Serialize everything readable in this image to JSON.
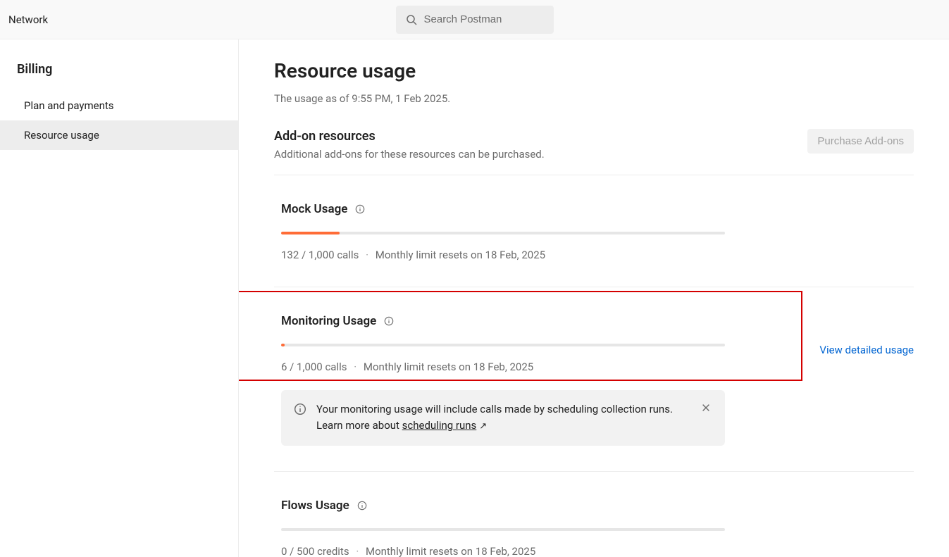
{
  "header": {
    "network_label": "Network",
    "search_placeholder": "Search Postman"
  },
  "sidebar": {
    "heading": "Billing",
    "items": [
      {
        "label": "Plan and payments",
        "active": false
      },
      {
        "label": "Resource usage",
        "active": true
      }
    ]
  },
  "main": {
    "title": "Resource usage",
    "asof_prefix": "The usage as of ",
    "asof_time": "9:55 PM, 1 Feb 2025",
    "asof_suffix": "."
  },
  "addons": {
    "heading": "Add-on resources",
    "subheading": "Additional add-ons for these resources can be purchased.",
    "purchase_btn": "Purchase Add-ons"
  },
  "usage_cards": [
    {
      "key": "mock",
      "title": "Mock Usage",
      "used": 132,
      "limit": 1000,
      "unit": "calls",
      "count_text": "132 / 1,000 calls",
      "reset_text": "Monthly limit resets on 18 Feb, 2025",
      "percent": 13.2,
      "highlight": false,
      "detailed_link": null,
      "banner": null
    },
    {
      "key": "monitoring",
      "title": "Monitoring Usage",
      "used": 6,
      "limit": 1000,
      "unit": "calls",
      "count_text": "6 / 1,000 calls",
      "reset_text": "Monthly limit resets on 18 Feb, 2025",
      "percent": 0.8,
      "highlight": true,
      "detailed_link": "View detailed usage",
      "banner": {
        "text_before": "Your monitoring usage will include calls made by scheduling collection runs. Learn more about ",
        "link_text": "scheduling runs"
      }
    },
    {
      "key": "flows",
      "title": "Flows Usage",
      "used": 0,
      "limit": 500,
      "unit": "credits",
      "count_text": "0 / 500 credits",
      "reset_text": "Monthly limit resets on 18 Feb, 2025",
      "percent": 0,
      "highlight": false,
      "detailed_link": null,
      "banner": null
    }
  ]
}
